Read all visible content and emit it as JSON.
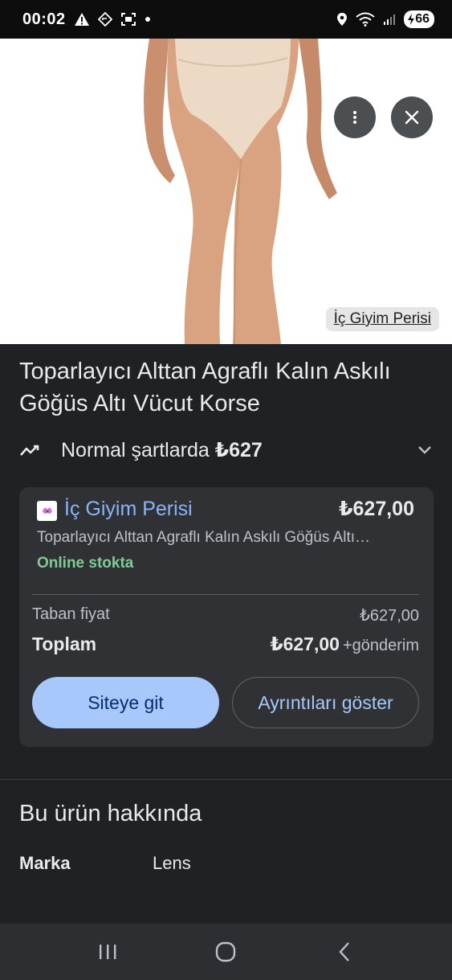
{
  "status_bar": {
    "time": "00:02",
    "battery": "66",
    "icons": [
      "warning-icon",
      "navigation-icon",
      "screenshot-icon",
      "dot-icon",
      "location-icon",
      "wifi-icon",
      "signal-icon",
      "battery-charging-icon"
    ]
  },
  "hero": {
    "source_chip": "İç Giyim Perisi",
    "actions": [
      "more-vert-icon",
      "close-icon"
    ]
  },
  "product": {
    "title": "Toparlayıcı Alttan Agraflı Kalın Askılı Göğüs Altı Vücut Korse",
    "price_prefix": "Normal şartlarda ",
    "price_value": "₺627"
  },
  "offer": {
    "store_name": "İç Giyim Perisi",
    "price": "₺627,00",
    "title": "Toparlayıcı Alttan Agraflı Kalın Askılı Göğüs Altı…",
    "stock": "Online stokta",
    "base_label": "Taban fiyat",
    "base_value": "₺627,00",
    "total_label": "Toplam",
    "total_value": "₺627,00",
    "shipping": "+gönderim",
    "primary_button": "Siteye git",
    "secondary_button": "Ayrıntıları göster"
  },
  "about": {
    "title": "Bu ürün hakkında",
    "attributes": [
      {
        "key": "Marka",
        "value": "Lens"
      }
    ]
  },
  "colors": {
    "background": "#202124",
    "card": "#303134",
    "link": "#8ab4f8",
    "stock": "#81c995",
    "primary_button": "#a8c7fa"
  }
}
